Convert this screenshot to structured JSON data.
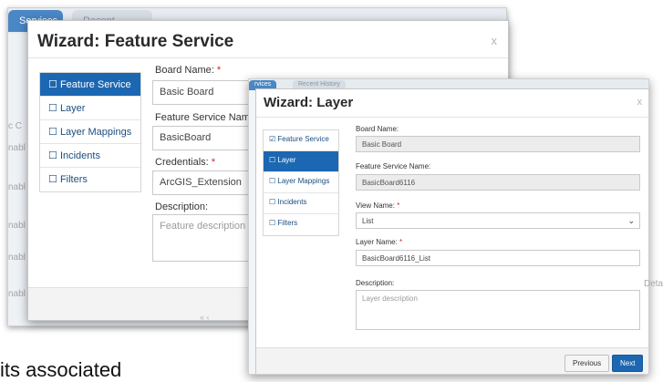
{
  "background_window": {
    "tabs": {
      "active": "Services",
      "inactive": "Recent History"
    },
    "row_fragments": [
      "c C",
      "nabl",
      "nabl",
      "nabl",
      "nabl",
      "nabl"
    ]
  },
  "wizard_feature_service": {
    "title": "Wizard: Feature Service",
    "close": "x",
    "nav": [
      {
        "label": "Feature Service",
        "icon": "checkbox-unchecked-icon"
      },
      {
        "label": "Layer",
        "icon": "checkbox-unchecked-icon"
      },
      {
        "label": "Layer Mappings",
        "icon": "checkbox-unchecked-icon"
      },
      {
        "label": "Incidents",
        "icon": "checkbox-unchecked-icon"
      },
      {
        "label": "Filters",
        "icon": "checkbox-unchecked-icon"
      }
    ],
    "board_name": {
      "label": "Board Name:",
      "value": "Basic Board",
      "required": "*"
    },
    "feature_service_name": {
      "label": "Feature Service Name:",
      "value": "BasicBoard",
      "required": "*"
    },
    "credentials": {
      "label": "Credentials:",
      "value": "ArcGIS_Extension",
      "required": "*"
    },
    "description": {
      "label": "Description:",
      "placeholder": "Feature description"
    },
    "pagination": "« ‹"
  },
  "wizard_layer": {
    "bg_tabs": {
      "active": "rvices",
      "inactive": "Recent History"
    },
    "title": "Wizard: Layer",
    "close": "x",
    "nav": [
      {
        "label": "Feature Service",
        "icon": "checkbox-checked-icon",
        "glyph": "☑"
      },
      {
        "label": "Layer",
        "icon": "checkbox-unchecked-icon",
        "glyph": "☐"
      },
      {
        "label": "Layer Mappings",
        "icon": "checkbox-unchecked-icon",
        "glyph": "☐"
      },
      {
        "label": "Incidents",
        "icon": "checkbox-unchecked-icon",
        "glyph": "☐"
      },
      {
        "label": "Filters",
        "icon": "checkbox-unchecked-icon",
        "glyph": "☐"
      }
    ],
    "board_name": {
      "label": "Board Name:",
      "value": "Basic Board"
    },
    "feature_service_name": {
      "label": "Feature Service Name:",
      "value": "BasicBoard6116"
    },
    "view_name": {
      "label": "View Name:",
      "value": "List",
      "required": "*"
    },
    "layer_name": {
      "label": "Layer Name:",
      "value": "BasicBoard6116_List",
      "required": "*"
    },
    "description": {
      "label": "Description:",
      "placeholder": "Layer description"
    },
    "buttons": {
      "previous": "Previous",
      "next": "Next"
    }
  },
  "side_text": "Detai",
  "caption": "its associated",
  "colors": {
    "nav_active": "#1c67b1",
    "required": "#e02020",
    "next_button": "#1c67b1"
  }
}
